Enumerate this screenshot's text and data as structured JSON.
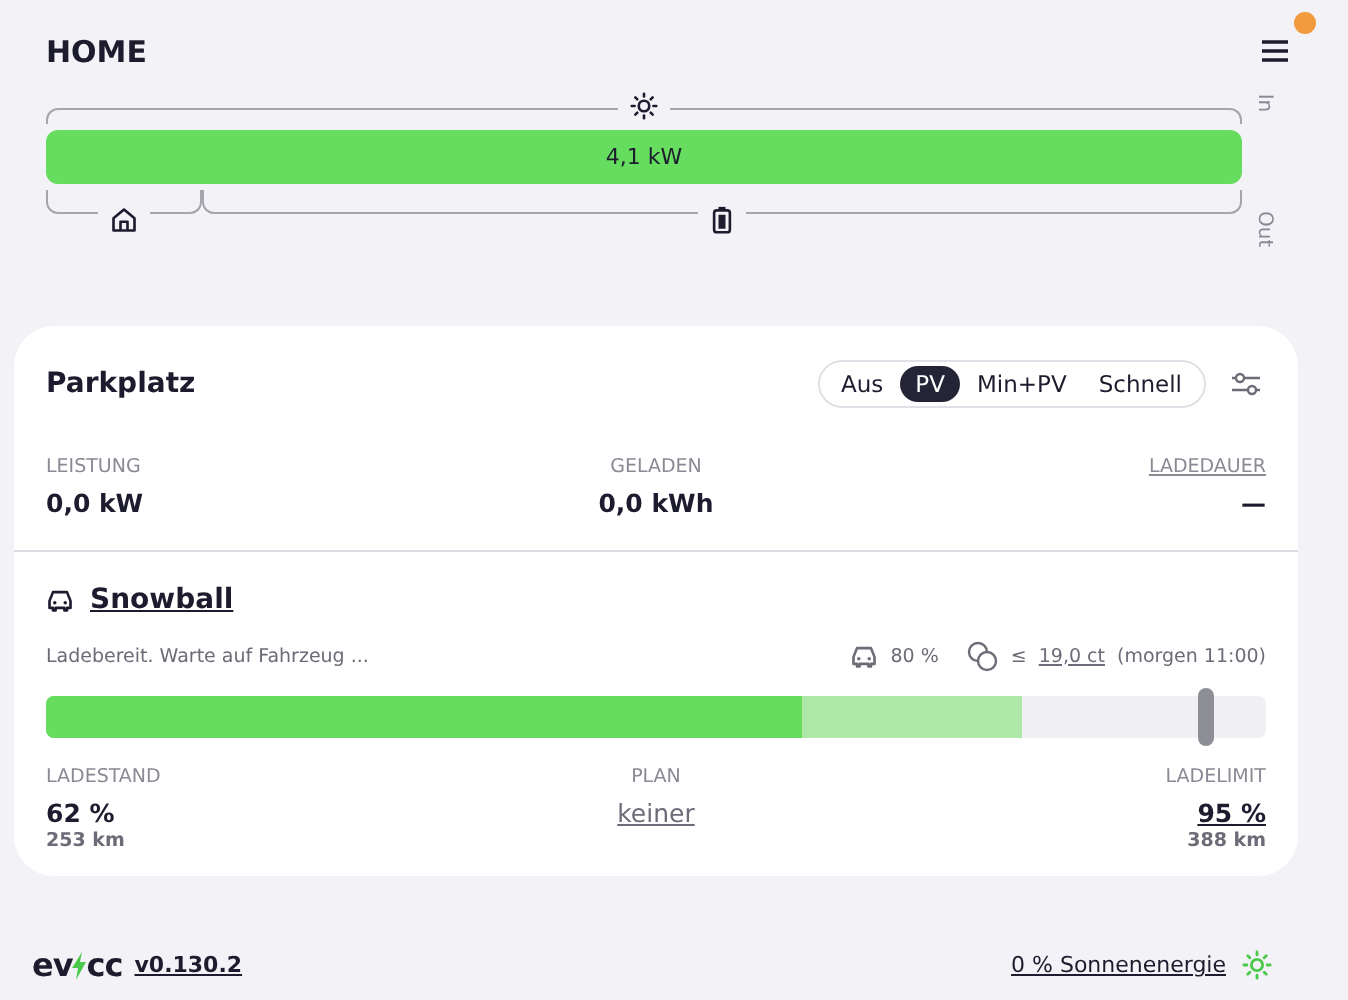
{
  "header": {
    "title": "HOME",
    "notification": true
  },
  "energy": {
    "in_label": "In",
    "out_label": "Out",
    "power": "4,1 kW",
    "level": 1,
    "consumers": [
      {
        "kind": "home"
      },
      {
        "kind": "battery"
      }
    ]
  },
  "loadpoint": {
    "title": "Parkplatz",
    "modes": [
      {
        "label": "Aus",
        "selected": false
      },
      {
        "label": "PV",
        "selected": true
      },
      {
        "label": "Min+PV",
        "selected": false
      },
      {
        "label": "Schnell",
        "selected": false
      }
    ],
    "stats": [
      {
        "label": "LEISTUNG",
        "value": "0,0 kW",
        "kind": "plain"
      },
      {
        "label": "GELADEN",
        "value": "0,0 kWh",
        "kind": "plain"
      },
      {
        "label": "LADEDAUER",
        "value": "—",
        "kind": "link"
      }
    ],
    "vehicle": {
      "name": "Snowball",
      "status": "Ladebereit. Warte auf Fahrzeug ...",
      "target": "80 %",
      "price_prefix": "≤",
      "price": "19,0 ct",
      "price_suffix": "(morgen 11:00)",
      "charge_bar": {
        "soc": {
          "level": 0.62
        },
        "target": {
          "level": 0.8
        },
        "limit": {
          "level": 0.95
        }
      },
      "stats": [
        {
          "label": "LADESTAND",
          "value": "62 %",
          "sub": "253 km",
          "kind": "plain"
        },
        {
          "label": "PLAN",
          "value": "keiner",
          "kind": "link"
        },
        {
          "label": "LADELIMIT",
          "value": "95 %",
          "sub": "388 km",
          "kind": "linkbold"
        }
      ]
    }
  },
  "footer": {
    "logo_left": "ev",
    "logo_right": "cc",
    "version": "v0.130.2",
    "solar": "0 % Sonnenenergie"
  }
}
